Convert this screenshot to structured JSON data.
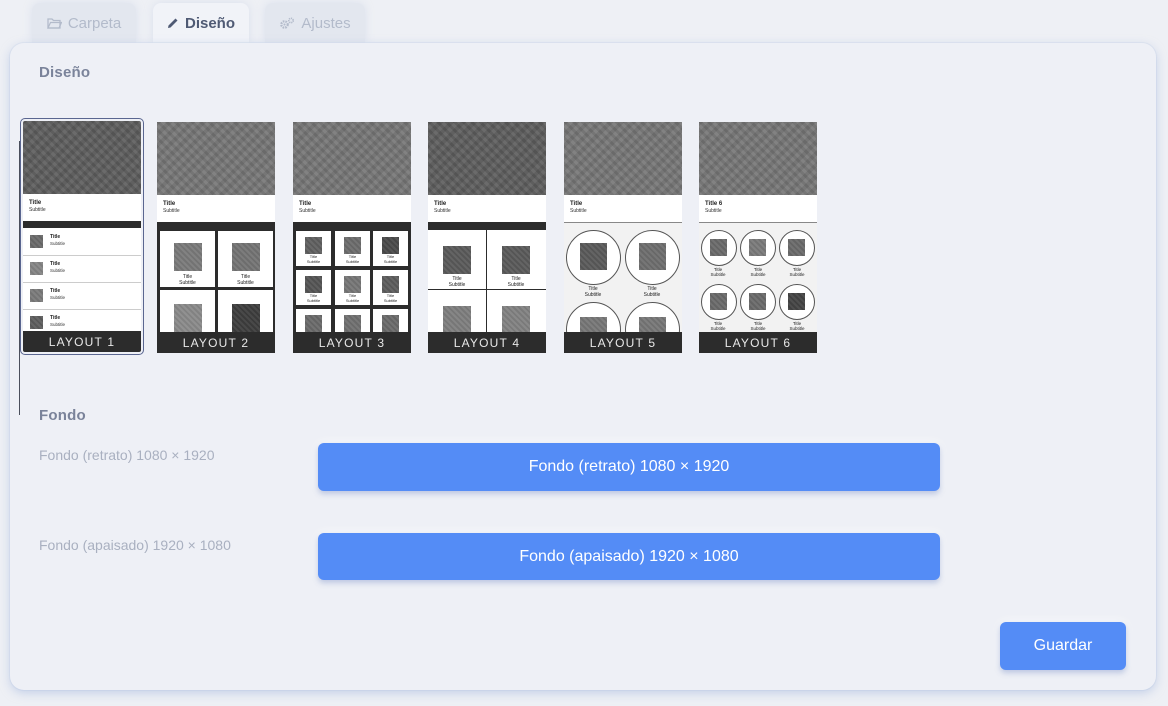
{
  "tabs": [
    {
      "label": "Carpeta",
      "icon": "folder-icon",
      "active": false
    },
    {
      "label": "Diseño",
      "icon": "pencil-icon",
      "active": true
    },
    {
      "label": "Ajustes",
      "icon": "gears-icon",
      "active": false
    }
  ],
  "design": {
    "title": "Diseño",
    "selected": "LAYOUT 1",
    "layouts": [
      {
        "label": "LAYOUT 1",
        "title": "Title",
        "subtitle": "Subtitle"
      },
      {
        "label": "LAYOUT 2",
        "title": "Title",
        "subtitle": "Subtitle"
      },
      {
        "label": "LAYOUT 3",
        "title": "Title",
        "subtitle": "Subtitle"
      },
      {
        "label": "LAYOUT 4",
        "title": "Title",
        "subtitle": "Subtitle"
      },
      {
        "label": "LAYOUT 5",
        "title": "Title",
        "subtitle": "Subtitle"
      },
      {
        "label": "LAYOUT 6",
        "title": "Title 6",
        "subtitle": "Subtitle"
      }
    ],
    "item_title": "Title",
    "item_subtitle": "Subtitle"
  },
  "background": {
    "title": "Fondo",
    "portrait_label": "Fondo (retrato) 1080 × 1920",
    "portrait_button": "Fondo (retrato) 1080 × 1920",
    "landscape_label": "Fondo (apaisado) 1920 × 1080",
    "landscape_button": "Fondo (apaisado) 1920 × 1080"
  },
  "save_button": "Guardar",
  "colors": {
    "accent": "#548cf6",
    "panel": "#eef0f6",
    "tab_active_text": "#4f5a74"
  }
}
